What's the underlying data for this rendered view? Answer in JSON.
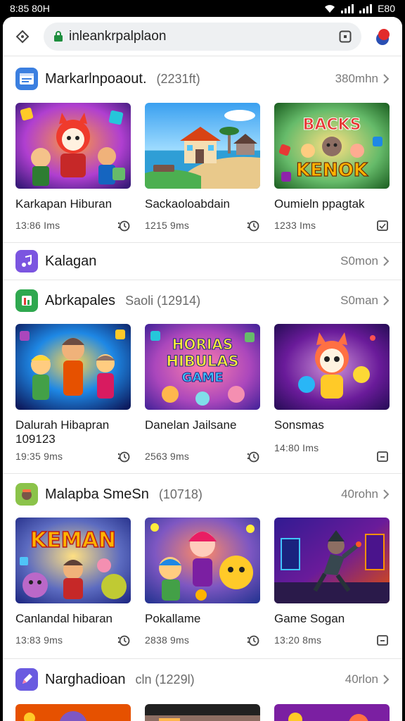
{
  "status_bar": {
    "time": "8:85 80H",
    "battery": "E80"
  },
  "browser": {
    "url": "inleankrpalplaon"
  },
  "sections": [
    {
      "title": "Markarlnpoaout.",
      "subtitle": "(2231ft)",
      "more": "380mhn",
      "icon_color": "#3b7fe0",
      "cards": [
        {
          "title": "Karkapan Hiburan",
          "time": "13:86 Ims"
        },
        {
          "title": "Sackaoloabdain",
          "time": "1215 9ms"
        },
        {
          "title": "Oumieln ppagtak",
          "time": "1233 Ims"
        }
      ]
    },
    {
      "title": "Kalagan",
      "subtitle": "",
      "more": "S0mon",
      "icon_color": "#7b55e0",
      "cards": []
    },
    {
      "title": "Abrkapales",
      "subtitle": "Saoli (12914)",
      "more": "S0man",
      "icon_color": "#2fa84f",
      "cards": [
        {
          "title": "Dalurah Hibapran",
          "title2": "109123",
          "time": "19:35 9ms"
        },
        {
          "title": "Danelan Jailsane",
          "time": "2563 9ms"
        },
        {
          "title": "Sonsmas",
          "time": "14:80 Ims"
        }
      ]
    },
    {
      "title": "Malapba SmeSn",
      "subtitle": "(10718)",
      "more": "40rohn",
      "icon_color": "#8bc34a",
      "cards": [
        {
          "title": "Canlandal hibaran",
          "time": "13:83 9ms"
        },
        {
          "title": "Pokallame",
          "time": "2838 9ms"
        },
        {
          "title": "Game Sogan",
          "time": "13:20 8ms"
        }
      ]
    },
    {
      "title": "Narghadioan",
      "subtitle": "cln (1229l)",
      "more": "40rlon",
      "icon_color": "#6a5be0",
      "cards": []
    }
  ],
  "thumb_texts": {
    "s0c0": "",
    "s0c1": "",
    "s0c2a": "BACKS",
    "s0c2b": "KENOK",
    "s2c0": "",
    "s2c1a": "HORIAS",
    "s2c1b": "HIBULAS",
    "s2c1c": "GAME",
    "s2c2": "",
    "s3c0": "KEMAN",
    "s3c1": "",
    "s3c2": ""
  }
}
